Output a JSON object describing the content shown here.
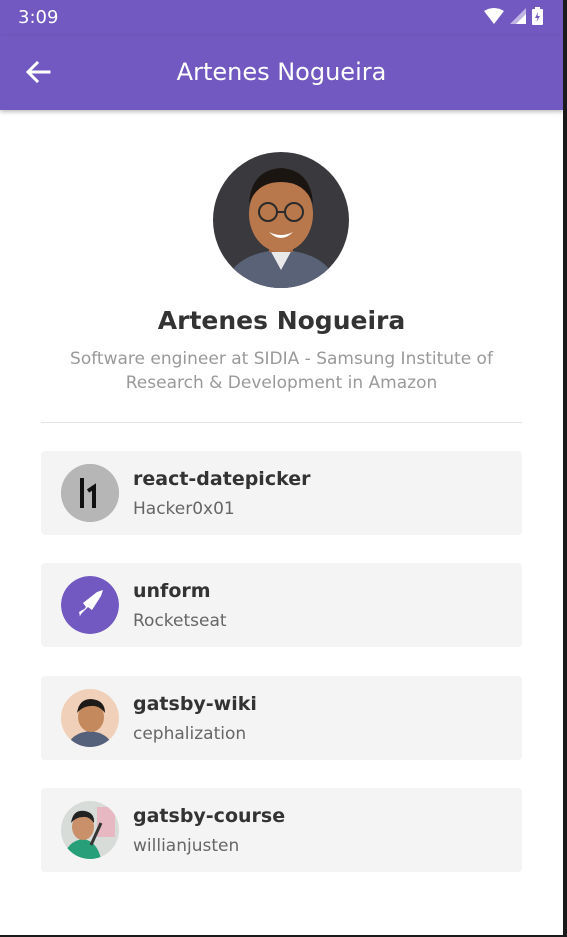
{
  "status_bar": {
    "time": "3:09",
    "icons": [
      "wifi-icon",
      "signal-icon",
      "battery-icon"
    ]
  },
  "app_bar": {
    "title": "Artenes Nogueira",
    "back_icon": "arrow-left-icon"
  },
  "profile": {
    "name": "Artenes Nogueira",
    "bio": "Software engineer at SIDIA - Samsung Institute of Research & Development in Amazon"
  },
  "repositories": [
    {
      "title": "react-datepicker",
      "author": "Hacker0x01"
    },
    {
      "title": "unform",
      "author": "Rocketseat"
    },
    {
      "title": "gatsby-wiki",
      "author": "cephalization"
    },
    {
      "title": "gatsby-course",
      "author": "willianjusten"
    }
  ],
  "colors": {
    "primary": "#7159c1",
    "card_background": "#f4f4f4",
    "title_text": "#333333",
    "subtitle_text": "#999999"
  }
}
